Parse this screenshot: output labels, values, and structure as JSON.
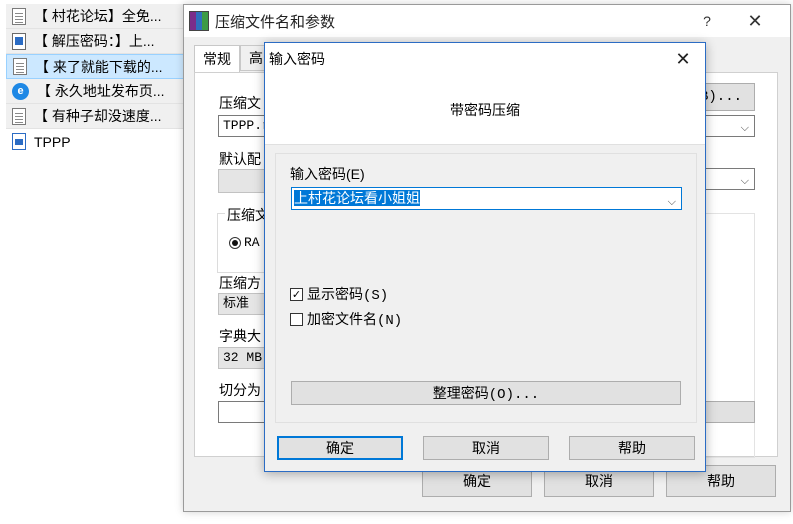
{
  "file_list": [
    {
      "icon": "doc-icon",
      "name": "【 村花论坛】全免..."
    },
    {
      "icon": "image-icon",
      "name": "【 解压密码：】上..."
    },
    {
      "icon": "doc-icon",
      "name": "【 来了就能下载的..."
    },
    {
      "icon": "link-icon",
      "name": "【 永久地址发布页..."
    },
    {
      "icon": "doc-icon",
      "name": "【 有种子却没速度..."
    },
    {
      "icon": "document-icon",
      "name": "TPPP"
    }
  ],
  "main_dialog": {
    "title": "压缩文件名和参数",
    "help_symbol": "?",
    "close_symbol": "✕",
    "tabs": [
      "常规",
      "高"
    ],
    "archive_name_label": "压缩文",
    "archive_name_value": "TPPP.r",
    "browse_button": "B)...",
    "profile_label": "默认配",
    "format_group_label": "压缩文",
    "format_value": "RA",
    "method_label": "压缩方",
    "method_value": "标准",
    "dict_label": "字典大",
    "dict_value": "32 MB",
    "split_label": "切分为",
    "ok": "确定",
    "cancel": "取消",
    "help": "帮助"
  },
  "password_dialog": {
    "title": "输入密码",
    "close_symbol": "✕",
    "header": "带密码压缩",
    "enter_label": "输入密码(E)",
    "password_value": "上村花论坛看小姐姐",
    "show_password": {
      "label": "显示密码(S)",
      "checked": true
    },
    "encrypt_names": {
      "label": "加密文件名(N)",
      "checked": false
    },
    "organize_button": "整理密码(O)...",
    "ok": "确定",
    "cancel": "取消",
    "help": "帮助"
  },
  "colors": {
    "accent": "#0078d7",
    "selection": "#cce8ff"
  }
}
